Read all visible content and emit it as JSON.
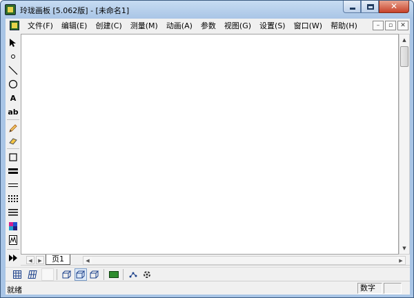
{
  "window": {
    "title": "玲珑画板 [5.062版] - [未命名1]",
    "controls": {
      "minimize": "minimize",
      "maximize": "maximize",
      "close": "✕"
    }
  },
  "menu": {
    "items": [
      "文件(F)",
      "编辑(E)",
      "创建(C)",
      "测量(M)",
      "动画(A)",
      "参数",
      "视图(G)",
      "设置(S)",
      "窗口(W)",
      "帮助(H)"
    ],
    "mdi_buttons": [
      "–",
      "▫",
      "✕"
    ]
  },
  "toolbox": {
    "tools": [
      {
        "name": "arrow-select-icon",
        "label": ""
      },
      {
        "name": "point-icon",
        "label": ""
      },
      {
        "name": "line-icon",
        "label": ""
      },
      {
        "name": "circle-icon",
        "label": ""
      },
      {
        "name": "text-tool",
        "label": "A"
      },
      {
        "name": "label-tool",
        "label": "ab"
      },
      {
        "name": "pencil-icon",
        "label": ""
      },
      {
        "name": "eraser-icon",
        "label": ""
      },
      {
        "name": "rectangle-icon",
        "label": ""
      },
      {
        "name": "thick-line-icon",
        "label": ""
      },
      {
        "name": "thin-line-icon",
        "label": ""
      },
      {
        "name": "dotted-grid-icon",
        "label": ""
      },
      {
        "name": "lines-icon",
        "label": ""
      },
      {
        "name": "color-palette-icon",
        "label": ""
      },
      {
        "name": "graph-icon",
        "label": ""
      },
      {
        "name": "fast-forward-icon",
        "label": ""
      }
    ]
  },
  "page_tab": {
    "label": "页1"
  },
  "bottom_toolbar": {
    "buttons": [
      "grid-icon",
      "oblique-grid-icon",
      "blank",
      "cube-view-1-icon",
      "cube-view-2-icon",
      "cube-view-3-icon",
      "green-rect-icon",
      "point-plot-icon",
      "gear-spin-icon"
    ]
  },
  "status": {
    "text": "就绪",
    "num_panel": "数字"
  },
  "colors": {
    "frame": "#a9c5e6",
    "client_bg": "#f0f0f0",
    "canvas_bg": "#ffffff",
    "close_btn": "#c7422a"
  }
}
